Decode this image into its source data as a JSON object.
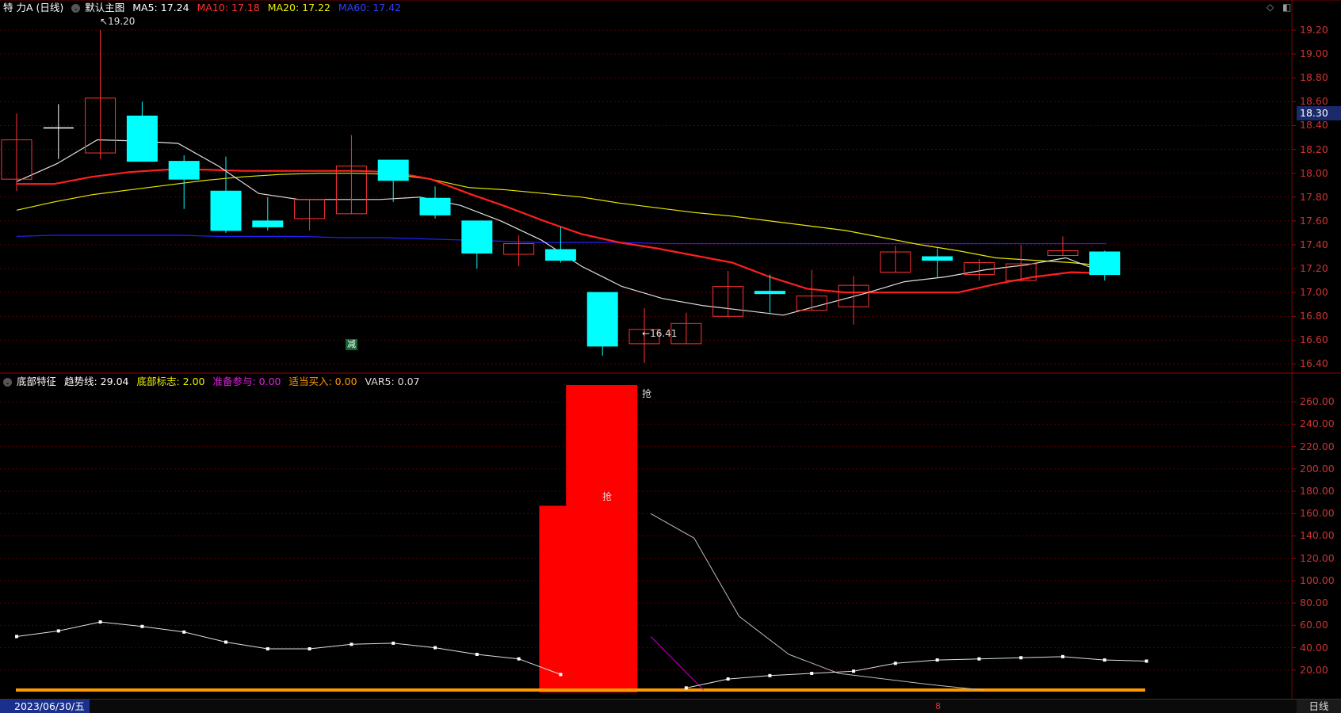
{
  "main_header": {
    "stock_name": "特 力A (日线)",
    "indicator_name": "默认主图",
    "ma5": "MA5: 17.24",
    "ma10": "MA10: 17.18",
    "ma20": "MA20: 17.22",
    "ma60": "MA60: 17.42"
  },
  "sub_header": {
    "indicator_name": "底部特征",
    "trend": "趋势线: 29.04",
    "bottom_flag": "底部标志: 2.00",
    "prepare": "准备参与: 0.00",
    "buy": "适当买入: 0.00",
    "var5": "VAR5: 0.07"
  },
  "colors": {
    "up": "#ff3333",
    "down": "#00ffff",
    "ma5": "#e0e0e0",
    "ma10": "#ff2020",
    "ma20": "#e8e800",
    "ma60": "#2020ff",
    "grid": "#5a0000",
    "axis_text": "#cc3333",
    "bar": "#ff0000",
    "orange": "#ff9900",
    "magenta": "#cc00cc"
  },
  "price_axis": [
    "19.20",
    "19.00",
    "18.80",
    "18.60",
    "18.40",
    "18.20",
    "18.00",
    "17.80",
    "17.60",
    "17.40",
    "17.20",
    "17.00",
    "16.80",
    "16.60",
    "16.40"
  ],
  "current_price": "18.30",
  "sub_axis": [
    "260.00",
    "240.00",
    "220.00",
    "200.00",
    "180.00",
    "160.00",
    "140.00",
    "120.00",
    "100.00",
    "80.00",
    "60.00",
    "40.00",
    "20.00"
  ],
  "high_mark": "19.20",
  "low_mark": "16.41",
  "signal_mark": "减",
  "bar_labels": [
    "抢",
    "抢"
  ],
  "chart_data": {
    "type": "candlestick",
    "price_range": [
      16.33,
      19.32
    ],
    "candles": [
      {
        "o": 17.95,
        "c": 18.28,
        "h": 18.5,
        "l": 17.85
      },
      {
        "o": 18.38,
        "c": 18.38,
        "h": 18.58,
        "l": 18.12
      },
      {
        "o": 18.17,
        "c": 18.63,
        "h": 19.2,
        "l": 18.12
      },
      {
        "o": 18.48,
        "c": 18.1,
        "h": 18.6,
        "l": 18.1
      },
      {
        "o": 18.1,
        "c": 17.95,
        "h": 18.15,
        "l": 17.7
      },
      {
        "o": 17.85,
        "c": 17.52,
        "h": 18.14,
        "l": 17.5
      },
      {
        "o": 17.6,
        "c": 17.55,
        "h": 17.8,
        "l": 17.52
      },
      {
        "o": 17.62,
        "c": 17.78,
        "h": 17.78,
        "l": 17.52
      },
      {
        "o": 17.66,
        "c": 18.06,
        "h": 18.32,
        "l": 17.66
      },
      {
        "o": 18.11,
        "c": 17.94,
        "h": 18.11,
        "l": 17.76
      },
      {
        "o": 17.79,
        "c": 17.65,
        "h": 17.89,
        "l": 17.62
      },
      {
        "o": 17.6,
        "c": 17.33,
        "h": 17.6,
        "l": 17.2
      },
      {
        "o": 17.32,
        "c": 17.41,
        "h": 17.48,
        "l": 17.22
      },
      {
        "o": 17.36,
        "c": 17.27,
        "h": 17.55,
        "l": 17.25
      },
      {
        "o": 17.0,
        "c": 16.55,
        "h": 17.0,
        "l": 16.47
      },
      {
        "o": 16.57,
        "c": 16.69,
        "h": 16.87,
        "l": 16.41
      },
      {
        "o": 16.57,
        "c": 16.74,
        "h": 16.83,
        "l": 16.57
      },
      {
        "o": 16.8,
        "c": 17.05,
        "h": 17.18,
        "l": 16.8
      },
      {
        "o": 17.01,
        "c": 16.99,
        "h": 17.15,
        "l": 16.83
      },
      {
        "o": 16.85,
        "c": 16.97,
        "h": 17.19,
        "l": 16.85
      },
      {
        "o": 16.88,
        "c": 17.06,
        "h": 17.14,
        "l": 16.73
      },
      {
        "o": 17.17,
        "c": 17.34,
        "h": 17.39,
        "l": 17.17
      },
      {
        "o": 17.3,
        "c": 17.27,
        "h": 17.37,
        "l": 17.12
      },
      {
        "o": 17.15,
        "c": 17.25,
        "h": 17.28,
        "l": 17.1
      },
      {
        "o": 17.1,
        "c": 17.24,
        "h": 17.4,
        "l": 17.1
      },
      {
        "o": 17.31,
        "c": 17.35,
        "h": 17.47,
        "l": 17.31
      },
      {
        "o": 17.34,
        "c": 17.15,
        "h": 17.35,
        "l": 17.1
      }
    ],
    "ma5": [
      17.93,
      18.08,
      18.28,
      18.27,
      18.25,
      18.06,
      17.83,
      17.78,
      17.78,
      17.78,
      17.8,
      17.73,
      17.6,
      17.44,
      17.22,
      17.05,
      16.95,
      16.89,
      16.85,
      16.81,
      16.9,
      16.99,
      17.09,
      17.13,
      17.19,
      17.23,
      17.29,
      17.16
    ],
    "ma10": [
      17.91,
      17.91,
      17.97,
      18.01,
      18.03,
      18.03,
      18.02,
      18.02,
      18.02,
      18.02,
      18.01,
      17.95,
      17.83,
      17.72,
      17.6,
      17.49,
      17.42,
      17.37,
      17.31,
      17.25,
      17.13,
      17.03,
      17.0,
      17.0,
      17.0,
      17.0,
      17.07,
      17.13,
      17.17,
      17.16
    ],
    "ma20": [
      17.69,
      17.76,
      17.82,
      17.86,
      17.9,
      17.94,
      17.97,
      17.99,
      18.0,
      18.0,
      17.99,
      17.95,
      17.88,
      17.86,
      17.83,
      17.8,
      17.75,
      17.71,
      17.67,
      17.64,
      17.6,
      17.56,
      17.52,
      17.46,
      17.4,
      17.35,
      17.29,
      17.27,
      17.25,
      17.22
    ],
    "ma60": [
      17.47,
      17.48,
      17.48,
      17.48,
      17.48,
      17.47,
      17.47,
      17.47,
      17.46,
      17.46,
      17.45,
      17.44,
      17.43,
      17.42,
      17.42,
      17.42,
      17.41,
      17.41,
      17.41,
      17.41,
      17.41,
      17.41,
      17.41,
      17.41,
      17.41,
      17.41,
      17.41,
      17.41
    ],
    "sub": {
      "range": [
        0,
        275
      ],
      "trend": [
        50,
        55,
        63,
        59,
        54,
        45,
        39,
        39,
        43,
        44,
        40,
        34,
        30,
        16,
        null,
        null,
        4,
        12,
        15,
        17,
        19,
        26,
        29,
        30,
        31,
        32,
        29,
        28
      ],
      "bars": [
        {
          "i": 13,
          "v": 167
        },
        {
          "i": 14,
          "v": 275
        },
        {
          "i": 15,
          "v": 275
        }
      ]
    }
  },
  "bottom": {
    "date": "2023/06/30/五",
    "period": "日线"
  }
}
